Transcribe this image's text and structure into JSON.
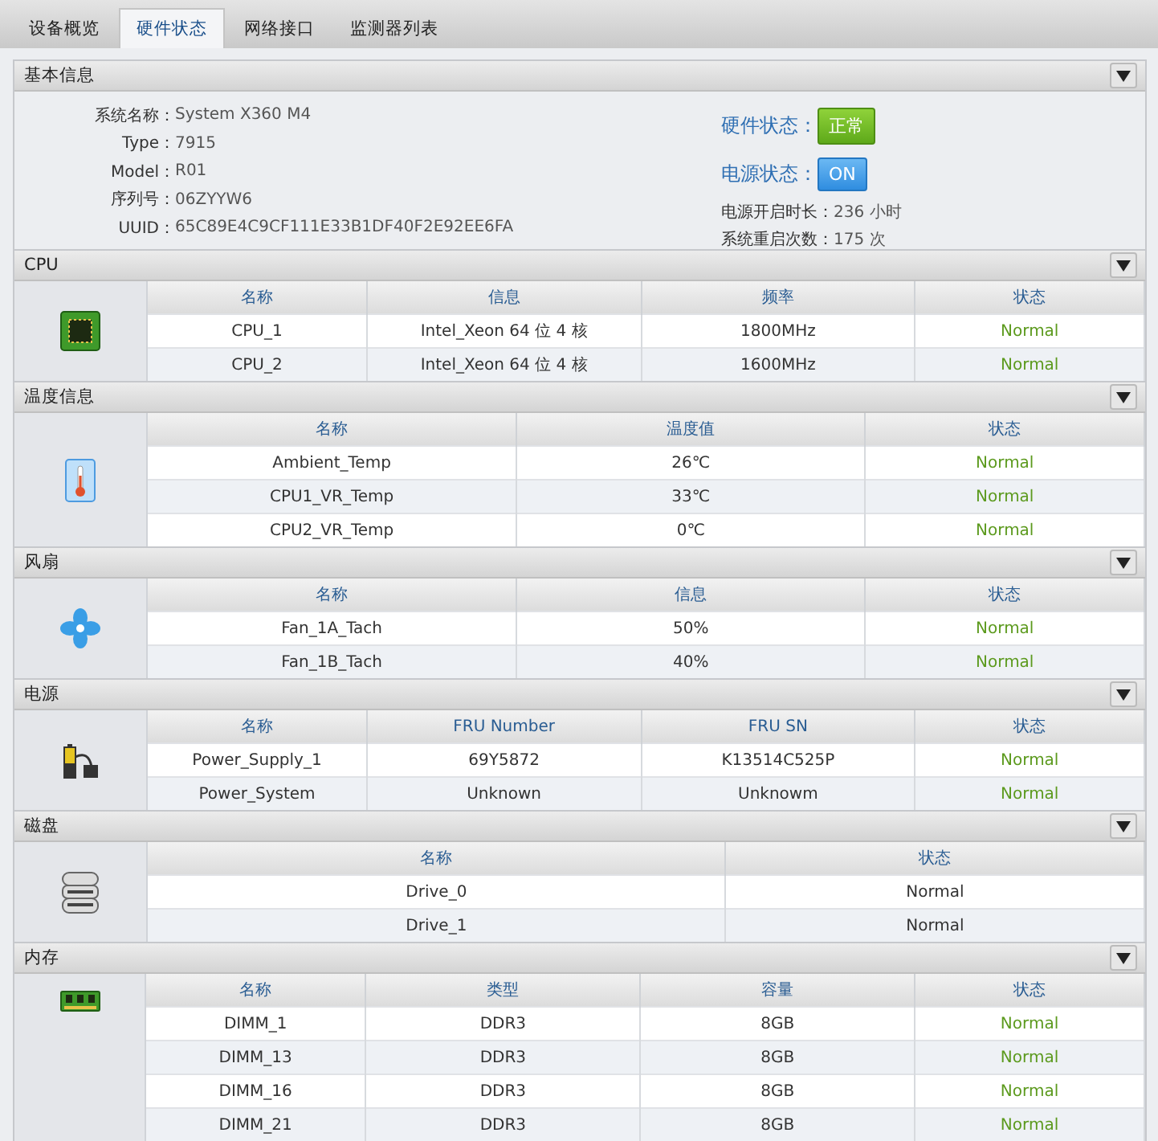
{
  "tabs": [
    {
      "label": "设备概览",
      "selected": false
    },
    {
      "label": "硬件状态",
      "selected": true
    },
    {
      "label": "网络接口",
      "selected": false
    },
    {
      "label": "监测器列表",
      "selected": false
    }
  ],
  "basic_info": {
    "title": "基本信息",
    "fields": [
      {
        "label": "系统名称：",
        "value": "System X360 M4"
      },
      {
        "label": "Type：",
        "value": "7915"
      },
      {
        "label": "Model：",
        "value": "R01"
      },
      {
        "label": "序列号：",
        "value": "06ZYYW6"
      },
      {
        "label": "UUID：",
        "value": "65C89E4C9CF111E33B1DF40F2E92EE6FA"
      }
    ],
    "badges": [
      {
        "label": "硬件状态：",
        "value": "正常",
        "kind": "ok"
      },
      {
        "label": "电源状态：",
        "value": "ON",
        "kind": "power"
      }
    ],
    "stats": [
      {
        "label": "电源开启时长：",
        "value": "236 小时"
      },
      {
        "label": "系统重启次数：",
        "value": "175 次"
      }
    ]
  },
  "sections": [
    {
      "title": "CPU",
      "kind": "cpu",
      "status_highlight": true,
      "columns": [
        "名称",
        "信息",
        "频率",
        "状态"
      ],
      "rows": [
        [
          "CPU_1",
          "Intel_Xeon 64 位 4 核",
          "1800MHz",
          "Normal"
        ],
        [
          "CPU_2",
          "Intel_Xeon 64 位 4 核",
          "1600MHz",
          "Normal"
        ]
      ]
    },
    {
      "title": "温度信息",
      "kind": "temperature",
      "status_highlight": true,
      "columns": [
        "名称",
        "温度值",
        "状态"
      ],
      "rows": [
        [
          "Ambient_Temp",
          "26℃",
          "Normal"
        ],
        [
          "CPU1_VR_Temp",
          "33℃",
          "Normal"
        ],
        [
          "CPU2_VR_Temp",
          "0℃",
          "Normal"
        ]
      ]
    },
    {
      "title": "风扇",
      "kind": "fan",
      "status_highlight": true,
      "columns": [
        "名称",
        "信息",
        "状态"
      ],
      "rows": [
        [
          "Fan_1A_Tach",
          "50%",
          "Normal"
        ],
        [
          "Fan_1B_Tach",
          "40%",
          "Normal"
        ]
      ]
    },
    {
      "title": "电源",
      "kind": "power",
      "status_highlight": true,
      "columns": [
        "名称",
        "FRU Number",
        "FRU SN",
        "状态"
      ],
      "rows": [
        [
          "Power_Supply_1",
          "69Y5872",
          "K13514C525P",
          "Normal"
        ],
        [
          "Power_System",
          "Unknown",
          "Unknowm",
          "Normal"
        ]
      ]
    },
    {
      "title": "磁盘",
      "kind": "disk",
      "status_highlight": false,
      "columns": [
        "名称",
        "状态"
      ],
      "rows": [
        [
          "Drive_0",
          "Normal"
        ],
        [
          "Drive_1",
          "Normal"
        ]
      ]
    },
    {
      "title": "内存",
      "kind": "memory",
      "status_highlight": true,
      "columns": [
        "名称",
        "类型",
        "容量",
        "状态"
      ],
      "rows": [
        [
          "DIMM_1",
          "DDR3",
          "8GB",
          "Normal"
        ],
        [
          "DIMM_13",
          "DDR3",
          "8GB",
          "Normal"
        ],
        [
          "DIMM_16",
          "DDR3",
          "8GB",
          "Normal"
        ],
        [
          "DIMM_21",
          "DDR3",
          "8GB",
          "Normal"
        ]
      ]
    }
  ]
}
